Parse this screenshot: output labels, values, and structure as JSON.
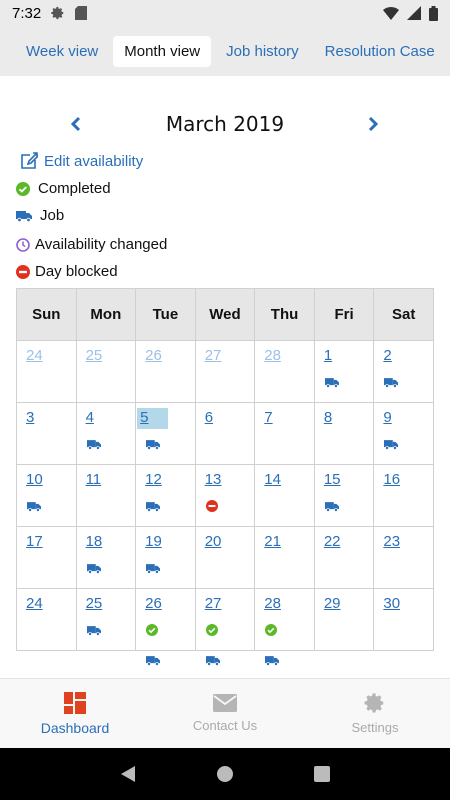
{
  "status_bar": {
    "time": "7:32"
  },
  "tabs": [
    {
      "label": "Week view",
      "active": false
    },
    {
      "label": "Month view",
      "active": true
    },
    {
      "label": "Job history",
      "active": false
    },
    {
      "label": "Resolution Case",
      "active": false
    }
  ],
  "calendar": {
    "month_title": "March 2019",
    "edit_label": "Edit availability",
    "legend": {
      "completed": "Completed",
      "job": "Job",
      "availability_changed": "Availability changed",
      "day_blocked": "Day blocked"
    },
    "weekdays": [
      "Sun",
      "Mon",
      "Tue",
      "Wed",
      "Thu",
      "Fri",
      "Sat"
    ],
    "weeks": [
      [
        {
          "d": "24",
          "m": true
        },
        {
          "d": "25",
          "m": true
        },
        {
          "d": "26",
          "m": true
        },
        {
          "d": "27",
          "m": true
        },
        {
          "d": "28",
          "m": true
        },
        {
          "d": "1",
          "job": true
        },
        {
          "d": "2",
          "job": true
        }
      ],
      [
        {
          "d": "3"
        },
        {
          "d": "4",
          "job": true
        },
        {
          "d": "5",
          "job": true,
          "today": true
        },
        {
          "d": "6"
        },
        {
          "d": "7"
        },
        {
          "d": "8"
        },
        {
          "d": "9",
          "job": true
        }
      ],
      [
        {
          "d": "10",
          "job": true
        },
        {
          "d": "11"
        },
        {
          "d": "12",
          "job": true
        },
        {
          "d": "13",
          "blocked": true
        },
        {
          "d": "14"
        },
        {
          "d": "15",
          "job": true
        },
        {
          "d": "16"
        }
      ],
      [
        {
          "d": "17"
        },
        {
          "d": "18",
          "job": true
        },
        {
          "d": "19",
          "job": true
        },
        {
          "d": "20"
        },
        {
          "d": "21"
        },
        {
          "d": "22"
        },
        {
          "d": "23"
        }
      ],
      [
        {
          "d": "24"
        },
        {
          "d": "25",
          "job": true
        },
        {
          "d": "26",
          "done": true,
          "job": true
        },
        {
          "d": "27",
          "done": true,
          "job": true
        },
        {
          "d": "28",
          "done": true,
          "job": true
        },
        {
          "d": "29"
        },
        {
          "d": "30"
        }
      ]
    ]
  },
  "bottom_nav": [
    {
      "label": "Dashboard",
      "icon": "dashboard-icon",
      "active": true
    },
    {
      "label": "Contact Us",
      "icon": "mail-icon",
      "active": false
    },
    {
      "label": "Settings",
      "icon": "gear-icon",
      "active": false
    }
  ],
  "colors": {
    "accent": "#2a6fb7",
    "completed": "#5cb82a",
    "blocked": "#e0311f",
    "availability": "#8e5fd1",
    "today": "#b2d8ea",
    "dashboard": "#e0421f"
  }
}
